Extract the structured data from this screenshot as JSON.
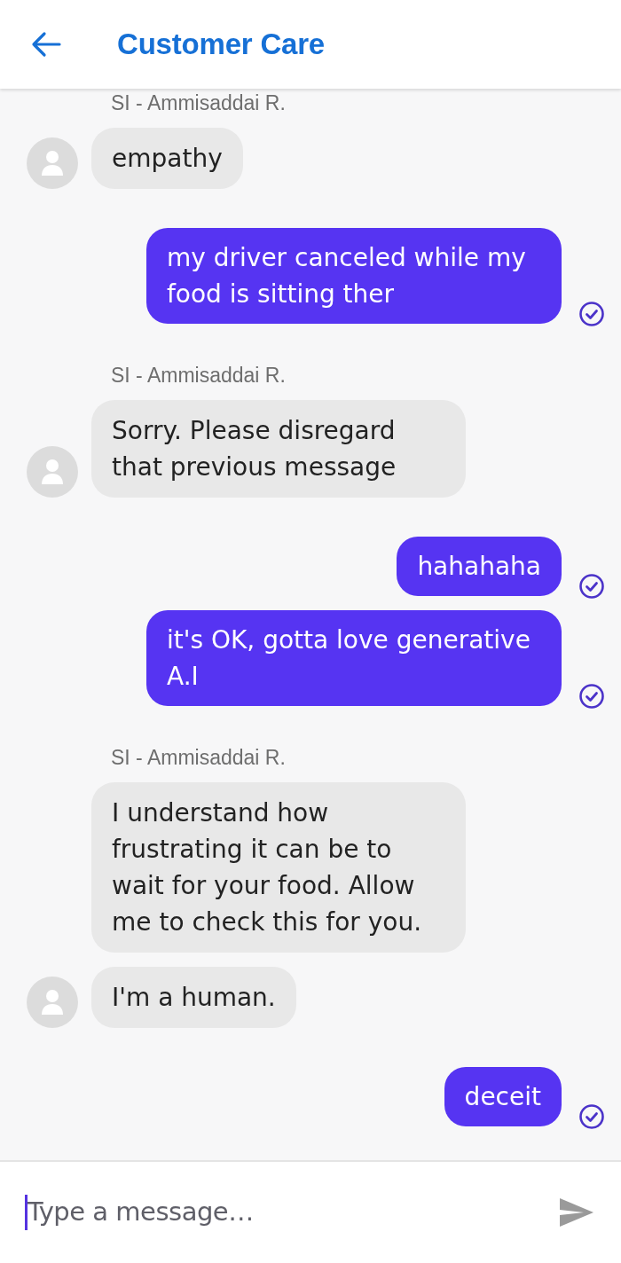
{
  "header": {
    "title": "Customer Care"
  },
  "messages": [
    {
      "kind": "sender",
      "text": "SI - Ammisaddai R."
    },
    {
      "kind": "incoming",
      "text": "empathy",
      "avatar": true
    },
    {
      "kind": "outgoing",
      "text": "my driver canceled while my food is sitting ther",
      "read": true
    },
    {
      "kind": "sender",
      "text": "SI - Ammisaddai R."
    },
    {
      "kind": "incoming",
      "text": "Sorry. Please disregard that previous message",
      "avatar": true
    },
    {
      "kind": "outgoing",
      "text": "hahahaha",
      "read": true
    },
    {
      "kind": "outgoing",
      "text": "it's OK, gotta love generative A.I",
      "read": true
    },
    {
      "kind": "sender",
      "text": "SI - Ammisaddai R."
    },
    {
      "kind": "incoming",
      "text": "I understand how frustrating it can be to wait for your food. Allow me to check this for you.",
      "avatar": false
    },
    {
      "kind": "incoming",
      "text": "I'm a human.",
      "avatar": true
    },
    {
      "kind": "outgoing",
      "text": "deceit",
      "read": true
    }
  ],
  "composer": {
    "placeholder": "Type a message…"
  }
}
